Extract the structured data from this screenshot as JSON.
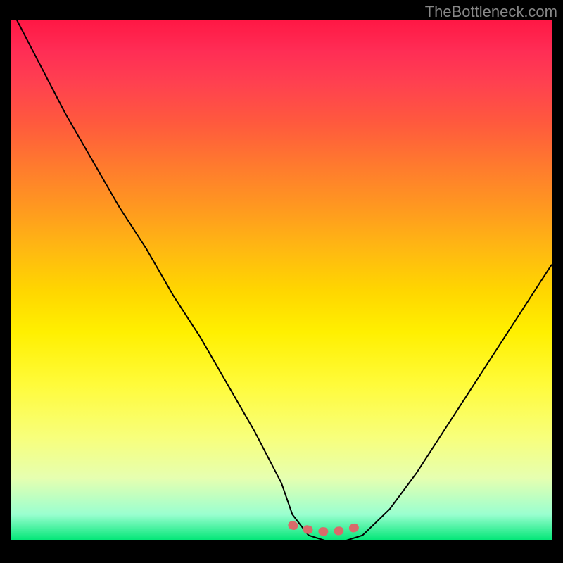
{
  "watermark": "TheBottleneck.com",
  "chart_data": {
    "type": "line",
    "title": "",
    "xlabel": "",
    "ylabel": "",
    "xlim": [
      0,
      100
    ],
    "ylim": [
      0,
      100
    ],
    "background_gradient": {
      "top": "#ff1744",
      "mid": "#ffd600",
      "bottom": "#00e676"
    },
    "series": [
      {
        "name": "curve",
        "x": [
          0,
          5,
          10,
          15,
          20,
          25,
          30,
          35,
          40,
          45,
          50,
          52,
          55,
          58,
          60,
          62,
          65,
          70,
          75,
          80,
          85,
          90,
          95,
          100
        ],
        "y": [
          102,
          92,
          82,
          73,
          64,
          56,
          47,
          39,
          30,
          21,
          11,
          5,
          1,
          0,
          0,
          0,
          1,
          6,
          13,
          21,
          29,
          37,
          45,
          53
        ]
      }
    ],
    "marker_region": {
      "x_start": 52,
      "x_end": 65,
      "y": 0.5,
      "color": "#d86a6a"
    }
  }
}
